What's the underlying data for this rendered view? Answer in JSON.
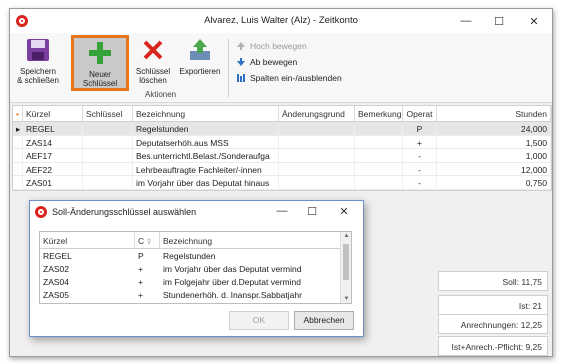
{
  "window": {
    "title": "Alvarez, Luis Walter (Alz) - Zeitkonto",
    "minimize": "—",
    "maximize": "☐",
    "close": "✕"
  },
  "ribbon": {
    "save_label_1": "Speichern",
    "save_label_2": "& schließen",
    "new_label_1": "Neuer",
    "new_label_2": "Schlüssel",
    "delete_label_1": "Schlüssel",
    "delete_label_2": "löschen",
    "export_label": "Exportieren",
    "group_label": "Aktionen",
    "move_up": "Hoch bewegen",
    "move_down": "Ab bewegen",
    "columns": "Spalten ein-/ausblenden"
  },
  "grid": {
    "headers": [
      "Kürzel",
      "Schlüssel",
      "Bezeichnung",
      "Änderungsgrund",
      "Bemerkung",
      "Operat",
      "Stunden"
    ],
    "rows": [
      {
        "kuerzel": "REGEL",
        "schluessel": "",
        "bezeichnung": "Regelstunden",
        "grund": "",
        "bemerkung": "",
        "op": "P",
        "stunden": "24,000"
      },
      {
        "kuerzel": "ZAS14",
        "schluessel": "",
        "bezeichnung": "Deputatserhöh.aus MSS",
        "grund": "",
        "bemerkung": "",
        "op": "+",
        "stunden": "1,500"
      },
      {
        "kuerzel": "AEF17",
        "schluessel": "",
        "bezeichnung": "Bes.unterrichtl.Belast./Sonderaufga",
        "grund": "",
        "bemerkung": "",
        "op": "-",
        "stunden": "1,000"
      },
      {
        "kuerzel": "AEF22",
        "schluessel": "",
        "bezeichnung": "Lehrbeauftragte Fachleiter/-innen",
        "grund": "",
        "bemerkung": "",
        "op": "-",
        "stunden": "12,000"
      },
      {
        "kuerzel": "ZAS01",
        "schluessel": "",
        "bezeichnung": "im Vorjahr über das Deputat hinaus",
        "grund": "",
        "bemerkung": "",
        "op": "-",
        "stunden": "0,750"
      }
    ]
  },
  "summary": {
    "soll": "Soll: 11,75",
    "ist": "Ist: 21",
    "anrechnungen": "Anrechnungen: 12,25",
    "ist_anrech": "Ist+Anrech.-Pflicht: 9,25"
  },
  "dialog": {
    "title": "Soll-Änderungsschlüssel auswählen",
    "headers": [
      "Kürzel",
      "C",
      "Bezeichnung"
    ],
    "rows": [
      {
        "kuerzel": "REGEL",
        "c": "P",
        "bezeichnung": "Regelstunden"
      },
      {
        "kuerzel": "ZAS02",
        "c": "+",
        "bezeichnung": "im Vorjahr über das Deputat vermind"
      },
      {
        "kuerzel": "ZAS04",
        "c": "+",
        "bezeichnung": "im Folgejahr über d.Deputat vermind"
      },
      {
        "kuerzel": "ZAS05",
        "c": "+",
        "bezeichnung": "Stundenerhöh. d. Inanspr.Sabbatjahr"
      }
    ],
    "ok": "OK",
    "cancel": "Abbrechen"
  },
  "colors": {
    "highlight": "#e8751a",
    "brand_red": "#d9251d"
  }
}
